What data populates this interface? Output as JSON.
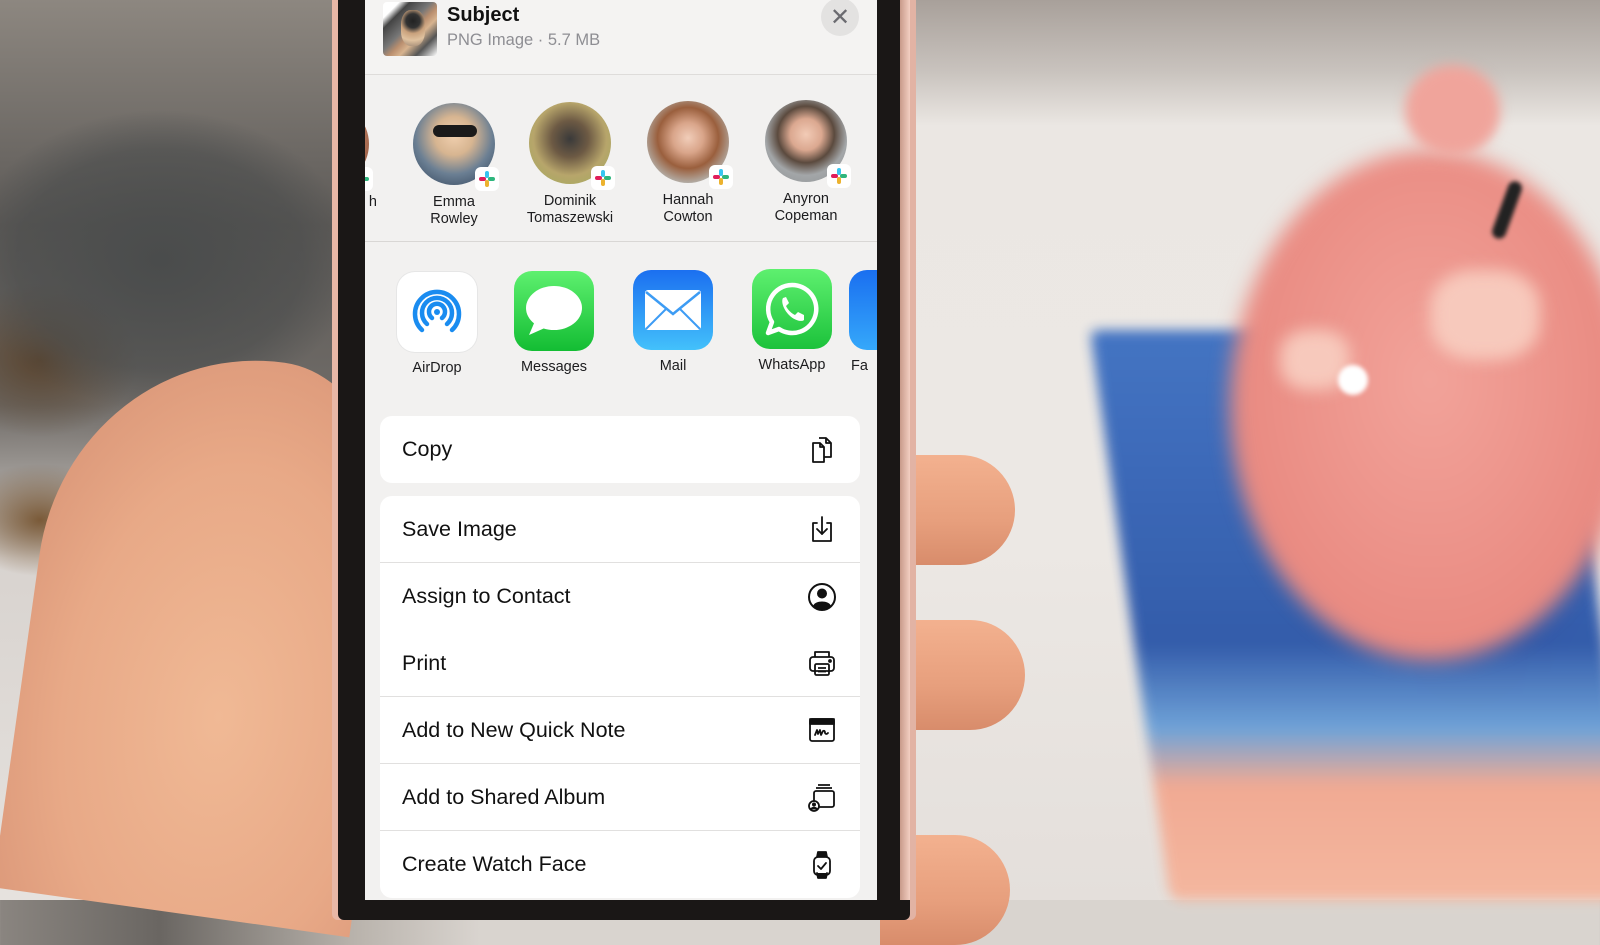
{
  "share_sheet": {
    "header": {
      "title": "Subject",
      "meta": "PNG Image · 5.7 MB",
      "close_icon": "close-icon",
      "close_glyph": "✕"
    },
    "people": [
      {
        "name_line1": "h",
        "name_line2": "",
        "badge": "slack-icon",
        "partial": true
      },
      {
        "name_line1": "Emma",
        "name_line2": "Rowley",
        "badge": "slack-icon"
      },
      {
        "name_line1": "Dominik",
        "name_line2": "Tomaszewski",
        "badge": "slack-icon"
      },
      {
        "name_line1": "Hannah",
        "name_line2": "Cowton",
        "badge": "slack-icon"
      },
      {
        "name_line1": "Anyron",
        "name_line2": "Copeman",
        "badge": "slack-icon"
      }
    ],
    "apps": [
      {
        "label": "AirDrop",
        "icon": "airdrop-icon",
        "color": "#1a8cf0"
      },
      {
        "label": "Messages",
        "icon": "messages-icon",
        "color": "#2fcf4f"
      },
      {
        "label": "Mail",
        "icon": "mail-icon",
        "color": "#1e7ff2"
      },
      {
        "label": "WhatsApp",
        "icon": "whatsapp-icon",
        "color": "#2ad24f"
      },
      {
        "label": "Fa",
        "icon": "files-icon",
        "color": "#1c84f3",
        "partial": true
      }
    ],
    "actions_group1": [
      {
        "label": "Copy",
        "icon": "copy-icon"
      }
    ],
    "actions_group2": [
      {
        "label": "Save Image",
        "icon": "save-image-icon"
      },
      {
        "label": "Assign to Contact",
        "icon": "contact-icon"
      },
      {
        "label": "Print",
        "icon": "printer-icon"
      },
      {
        "label": "Add to New Quick Note",
        "icon": "quick-note-icon"
      },
      {
        "label": "Add to Shared Album",
        "icon": "shared-album-icon"
      },
      {
        "label": "Create Watch Face",
        "icon": "watch-face-icon"
      }
    ]
  }
}
